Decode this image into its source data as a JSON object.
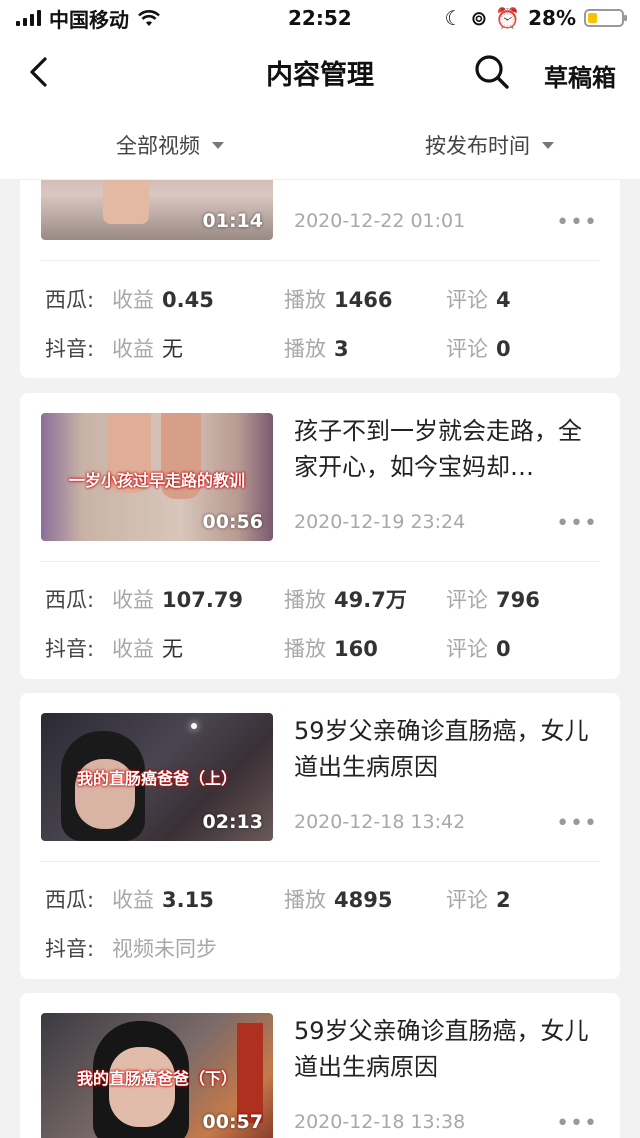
{
  "status_bar": {
    "carrier": "中国移动",
    "time": "22:52",
    "battery_pct": "28%",
    "battery_level": 0.28
  },
  "nav": {
    "title": "内容管理",
    "drafts_label": "草稿箱",
    "icons": [
      "back-chevron-icon",
      "search-icon"
    ]
  },
  "filters": {
    "video_filter": "全部视频",
    "sort_filter": "按发布时间"
  },
  "platform_labels": {
    "xigua": "西瓜:",
    "douyin": "抖音:"
  },
  "metric_labels": {
    "revenue": "收益",
    "plays": "播放",
    "comments": "评论"
  },
  "videos": [
    {
      "thumb_caption": "",
      "duration": "01:14",
      "title": "",
      "date": "2020-12-22 01:01",
      "xigua": {
        "revenue": "0.45",
        "plays": "1466",
        "comments": "4"
      },
      "douyin": {
        "revenue": "无",
        "plays": "3",
        "comments": "0"
      }
    },
    {
      "thumb_caption": "一岁小孩过早走路的教训",
      "duration": "00:56",
      "title": "孩子不到一岁就会走路，全家开心，如今宝妈却…",
      "date": "2020-12-19 23:24",
      "xigua": {
        "revenue": "107.79",
        "plays": "49.7万",
        "comments": "796"
      },
      "douyin": {
        "revenue": "无",
        "plays": "160",
        "comments": "0"
      }
    },
    {
      "thumb_caption": "我的直肠癌爸爸（上）",
      "duration": "02:13",
      "title": "59岁父亲确诊直肠癌，女儿道出生病原因",
      "date": "2020-12-18 13:42",
      "xigua": {
        "revenue": "3.15",
        "plays": "4895",
        "comments": "2"
      },
      "douyin_status": "视频未同步"
    },
    {
      "thumb_caption": "我的直肠癌爸爸（下）",
      "duration": "00:57",
      "title": "59岁父亲确诊直肠癌，女儿道出生病原因",
      "date": "2020-12-18 13:38"
    }
  ],
  "more_glyph": "•••"
}
